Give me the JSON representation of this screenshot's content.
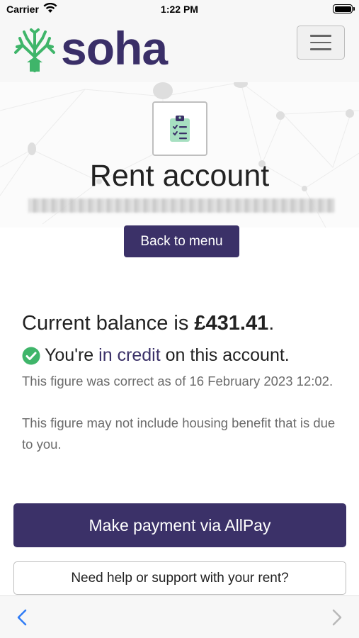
{
  "status_bar": {
    "carrier": "Carrier",
    "time": "1:22 PM",
    "wifi_icon": "wifi-icon",
    "battery_icon": "battery-icon"
  },
  "header": {
    "logo_text": "soha",
    "logo_icon": "tree-logo-icon",
    "menu_icon": "hamburger-menu-icon",
    "brand_color": "#3b3168",
    "logo_green": "#3fb56a"
  },
  "hero": {
    "icon": "clipboard-checklist-icon",
    "title": "Rent account"
  },
  "actions": {
    "back_label": "Back to menu",
    "pay_label": "Make payment via AllPay",
    "help_label": "Need help or support with your rent?"
  },
  "balance": {
    "prefix": "Current balance is ",
    "amount": "£431.41",
    "suffix": "."
  },
  "credit": {
    "icon": "check-circle-icon",
    "prefix": "You're ",
    "link": "in credit",
    "suffix": " on this account."
  },
  "notes": {
    "as_of": "This figure was correct as of 16 February 2023 12:02.",
    "benefit": "This figure may not include housing benefit that is due to you."
  },
  "toolbar": {
    "back_icon": "chevron-left-icon",
    "forward_icon": "chevron-right-icon"
  }
}
